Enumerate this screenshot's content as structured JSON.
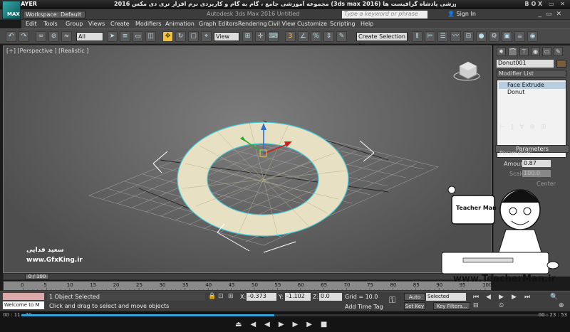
{
  "player": {
    "logo": "KMPLAYER",
    "title": "مجموعه آموزشی جامع ، گام به گام و کاربردی نرم افزار تری دی مکس 2016 (3ds max 2016) مدرس : سعید فدایی (تیچرمن) گروه آموزشی پادشاه گرافیست ها",
    "right_label": "BOX",
    "time_current": "00 : 11 : 28",
    "time_total": "00 : 23 : 53",
    "progress": 0.48
  },
  "max": {
    "logo": "MAX",
    "workspace": "Workspace: Default",
    "doc_title": "Autodesk 3ds Max 2016    Untitled",
    "search_placeholder": "Type a keyword or phrase",
    "signin": "Sign In"
  },
  "menu": [
    "Edit",
    "Tools",
    "Group",
    "Views",
    "Create",
    "Modifiers",
    "Animation",
    "Graph Editors",
    "Rendering",
    "Civil View",
    "Customize",
    "Scripting",
    "Help"
  ],
  "toolbar": {
    "filter": "All",
    "refcoord": "View",
    "selection_set": "Create Selection Se"
  },
  "viewport": {
    "label": "[+] [Perspective ] [Realistic ]"
  },
  "command_panel": {
    "object_name": "Donut001",
    "modifier_list": "Modifier List",
    "stack": [
      "Face Extrude",
      "Donut"
    ],
    "rollout": "Parameters",
    "group": "Parameters",
    "amount_label": "Amount:",
    "amount_value": "0.87",
    "scale_label": "Scale:",
    "scale_value": "100.0",
    "center_label": "Center"
  },
  "timeline": {
    "slider": "0 / 100",
    "ticks": [
      "0",
      "5",
      "10",
      "15",
      "20",
      "25",
      "30",
      "35",
      "40",
      "45",
      "50",
      "55",
      "60",
      "65",
      "70",
      "75",
      "80",
      "85",
      "90",
      "95",
      "100"
    ]
  },
  "status": {
    "maxscript": "Welcome to M",
    "selection": "1 Object Selected",
    "prompt": "Click and drag to select and move objects",
    "x_label": "X:",
    "x_value": "-0.373",
    "y_label": "Y:",
    "y_value": "-1.102",
    "z_label": "Z:",
    "z_value": "0.0",
    "grid": "Grid = 10.0",
    "add_time_tag": "Add Time Tag",
    "auto_key": "Auto Key",
    "set_key": "Set Key",
    "selected": "Selected",
    "key_filters": "Key Filters..."
  },
  "watermark": {
    "name": "سعید فدایی",
    "site": "www.GfxKing.ir"
  },
  "teacher": {
    "site": "www.TeacherMan.ir",
    "brand": "Teacher Man"
  }
}
